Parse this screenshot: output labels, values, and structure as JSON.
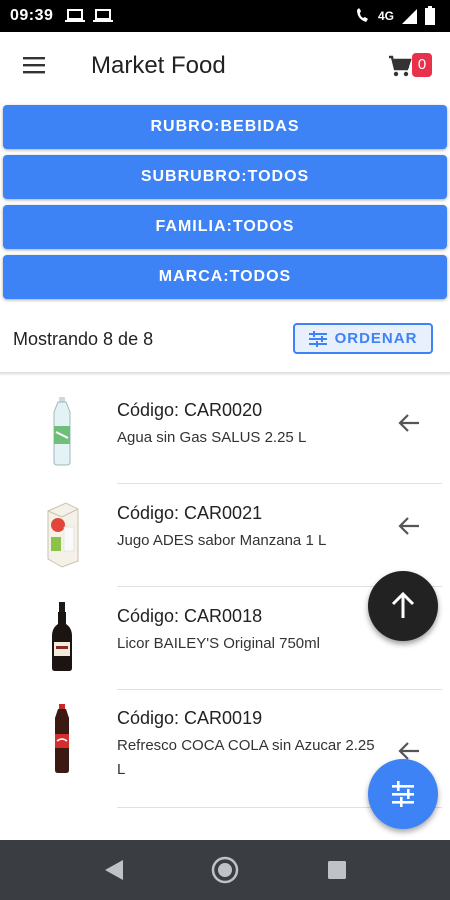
{
  "status_bar": {
    "time": "09:39",
    "network": "4G"
  },
  "app_bar": {
    "title": "Market Food",
    "cart_count": "0"
  },
  "filters": [
    {
      "label": "RUBRO:BEBIDAS"
    },
    {
      "label": "SUBRUBRO:TODOS"
    },
    {
      "label": "FAMILIA:TODOS"
    },
    {
      "label": "MARCA:TODOS"
    }
  ],
  "list_header": {
    "count_text": "Mostrando 8 de 8",
    "order_label": "ORDENAR"
  },
  "products": [
    {
      "code": "Código: CAR0020",
      "description": "Agua sin Gas SALUS 2.25 L",
      "image": "water-bottle"
    },
    {
      "code": "Código: CAR0021",
      "description": "Jugo ADES sabor Manzana 1 L",
      "image": "juice-carton"
    },
    {
      "code": "Código: CAR0018",
      "description": "Licor BAILEY'S Original 750ml",
      "image": "liquor-bottle"
    },
    {
      "code": "Código: CAR0019",
      "description": "Refresco COCA COLA sin Azucar 2.25 L",
      "image": "soda-bottle"
    }
  ],
  "colors": {
    "primary": "#3d83f5",
    "badge": "#e8324b",
    "fab_dark": "#222222",
    "navbar": "#3a3d42"
  },
  "icons": [
    "menu-icon",
    "cart-icon",
    "sliders-icon",
    "arrow-left-icon",
    "arrow-up-icon",
    "nav-back-icon",
    "nav-home-icon",
    "nav-recent-icon"
  ]
}
